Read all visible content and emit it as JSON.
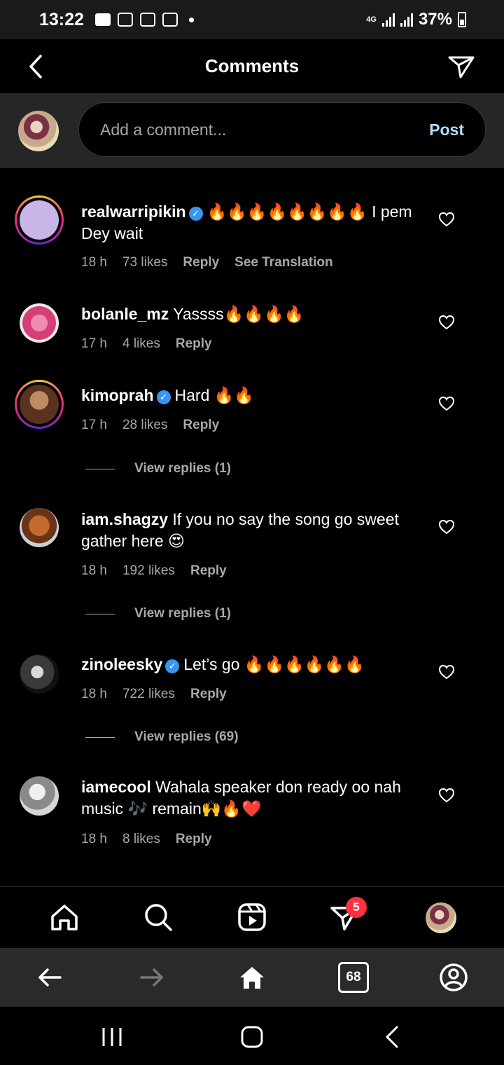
{
  "status_bar": {
    "time": "13:22",
    "network": "4G",
    "battery": "37%"
  },
  "header": {
    "title": "Comments"
  },
  "composer": {
    "placeholder": "Add a comment...",
    "post_label": "Post"
  },
  "comments": [
    {
      "username": "realwarripikin",
      "verified": true,
      "text": "🔥🔥🔥🔥🔥🔥🔥🔥 I pem Dey wait",
      "time": "18 h",
      "likes": "73 likes",
      "reply": "Reply",
      "translate": "See Translation",
      "avatar_color": "#c9b6e8",
      "story_ring": true
    },
    {
      "username": "bolanle_mz",
      "verified": false,
      "text": "Yassss🔥🔥🔥🔥",
      "time": "17 h",
      "likes": "4 likes",
      "reply": "Reply",
      "avatar_color": "#e0568f",
      "story_ring": false
    },
    {
      "username": "kimoprah",
      "verified": true,
      "text": "Hard 🔥🔥",
      "time": "17 h",
      "likes": "28 likes",
      "reply": "Reply",
      "avatar_color": "#8a5a3c",
      "story_ring": true,
      "view_replies": "View replies (1)"
    },
    {
      "username": "iam.shagzy",
      "verified": false,
      "text": "If you no say the song go sweet gather here 😍",
      "time": "18 h",
      "likes": "192 likes",
      "reply": "Reply",
      "avatar_color": "#7a4020",
      "story_ring": false,
      "view_replies": "View replies (1)"
    },
    {
      "username": "zinoleesky",
      "verified": true,
      "text": "Let’s go 🔥🔥🔥🔥🔥🔥",
      "time": "18 h",
      "likes": "722 likes",
      "reply": "Reply",
      "avatar_color": "#2b2b2b",
      "story_ring": false,
      "view_replies": "View replies (69)"
    },
    {
      "username": "iamecool",
      "verified": false,
      "text": "Wahala speaker don ready oo nah music 🎶 remain🙌🔥❤️",
      "time": "18 h",
      "likes": "8 likes",
      "reply": "Reply",
      "avatar_color": "#9a9a9a",
      "story_ring": false
    }
  ],
  "tab_bar": {
    "notification_count": "5",
    "items": [
      "home-icon",
      "search-icon",
      "reels-icon",
      "activity-icon",
      "profile-avatar"
    ]
  },
  "browser_bar": {
    "tabs_count": "68"
  },
  "colors": {
    "background": "#000000",
    "secondary_text": "#a8a8a8",
    "post_link": "#b2dffc",
    "verified": "#3797f0",
    "badge": "#ff3040"
  }
}
